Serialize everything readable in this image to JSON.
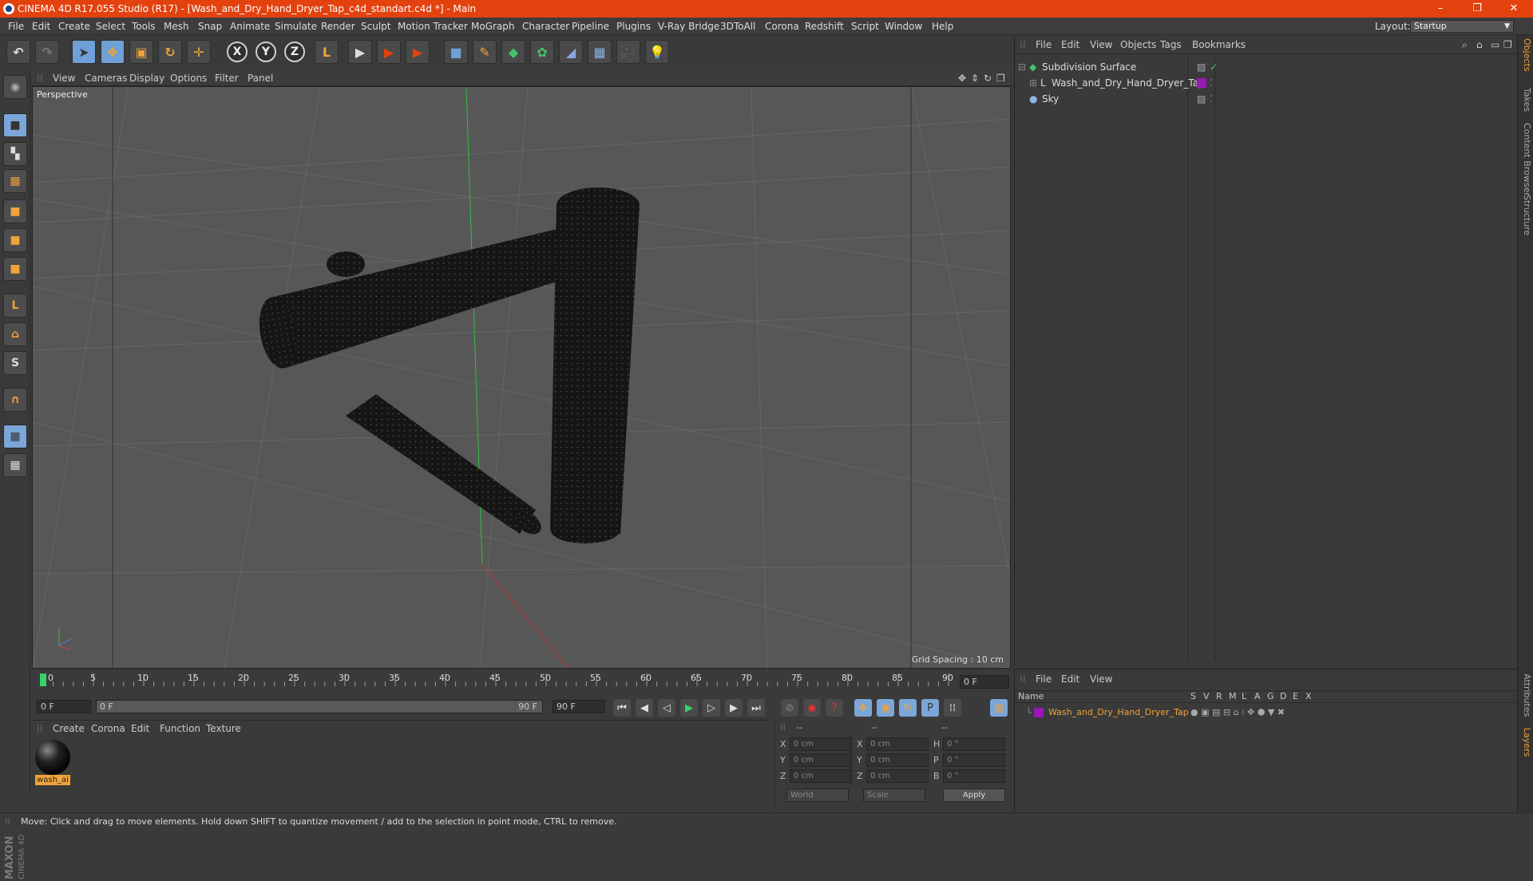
{
  "window": {
    "title": "CINEMA 4D R17.055 Studio (R17) - [Wash_and_Dry_Hand_Dryer_Tap_c4d_standart.c4d *] - Main",
    "minimize": "–",
    "restore": "❐",
    "close": "✕"
  },
  "menubar": {
    "items": [
      "File",
      "Edit",
      "Create",
      "Select",
      "Tools",
      "Mesh",
      "Snap",
      "Animate",
      "Simulate",
      "Render",
      "Sculpt",
      "Motion Tracker",
      "MoGraph",
      "Character",
      "Pipeline",
      "Plugins",
      "V-Ray Bridge",
      "3DToAll",
      "Corona",
      "Redshift",
      "Script",
      "Window",
      "Help"
    ],
    "layout_label": "Layout:",
    "layout_value": "Startup"
  },
  "toolbar": {
    "undo": "↶",
    "redo": "↷",
    "select": "➤",
    "move": "✥",
    "scale": "▣",
    "rotate": "↻",
    "transform": "✛",
    "x": "X",
    "y": "Y",
    "z": "Z",
    "coord": "L",
    "render1": "▶",
    "render2": "▶",
    "render3": "▶",
    "cube": "■",
    "pen": "✎",
    "subdiv": "◆",
    "mograph": "✿",
    "deform": "◢",
    "floor": "▦",
    "camera": "🎥",
    "light": "💡"
  },
  "viewport": {
    "menu": [
      "View",
      "Cameras",
      "Display",
      "Options",
      "Filter",
      "Panel"
    ],
    "label": "Perspective",
    "grid_spacing": "Grid Spacing : 10 cm"
  },
  "timeline": {
    "ticks": [
      "0",
      "5",
      "10",
      "15",
      "20",
      "25",
      "30",
      "35",
      "40",
      "45",
      "50",
      "55",
      "60",
      "65",
      "70",
      "75",
      "80",
      "85",
      "90"
    ],
    "current_frame": "0 F",
    "start": "0 F",
    "range_start": "0 F",
    "range_end": "90 F",
    "end": "90 F"
  },
  "material_panel": {
    "menu": [
      "Create",
      "Corona",
      "Edit",
      "Function",
      "Texture"
    ],
    "material_name": "wash_ai"
  },
  "coord_panel": {
    "headers": [
      "--",
      "--",
      "--"
    ],
    "rows": [
      {
        "a": "X",
        "v1": "0 cm",
        "b": "X",
        "v2": "0 cm",
        "c": "H",
        "v3": "0 °"
      },
      {
        "a": "Y",
        "v1": "0 cm",
        "b": "Y",
        "v2": "0 cm",
        "c": "P",
        "v3": "0 °"
      },
      {
        "a": "Z",
        "v1": "0 cm",
        "b": "Z",
        "v2": "0 cm",
        "c": "B",
        "v3": "0 °"
      }
    ],
    "world": "World",
    "scale": "Scale",
    "apply": "Apply"
  },
  "object_manager": {
    "menu": [
      "File",
      "Edit",
      "View",
      "Objects",
      "Tags",
      "Bookmarks"
    ],
    "objects": [
      "Subdivision Surface",
      "Wash_and_Dry_Hand_Dryer_Tap",
      "Sky"
    ]
  },
  "layer_manager": {
    "menu": [
      "File",
      "Edit",
      "View"
    ],
    "col_name": "Name",
    "cols": [
      "S",
      "V",
      "R",
      "M",
      "L",
      "A",
      "G",
      "D",
      "E",
      "X"
    ],
    "layer_name": "Wash_and_Dry_Hand_Dryer_Tap"
  },
  "side_tabs": [
    "Objects",
    "Takes",
    "Content Browser",
    "Structure",
    "Attributes",
    "Layers"
  ],
  "maxon_logo": {
    "line1": "MAXON",
    "line2": "CINEMA 4D"
  },
  "status": "Move: Click and drag to move elements. Hold down SHIFT to quantize movement / add to the selection in point mode, CTRL to remove.",
  "colors": {
    "title_bar": "#e3420f",
    "accent": "#f0a33a",
    "layer_color": "#9a18b8"
  }
}
